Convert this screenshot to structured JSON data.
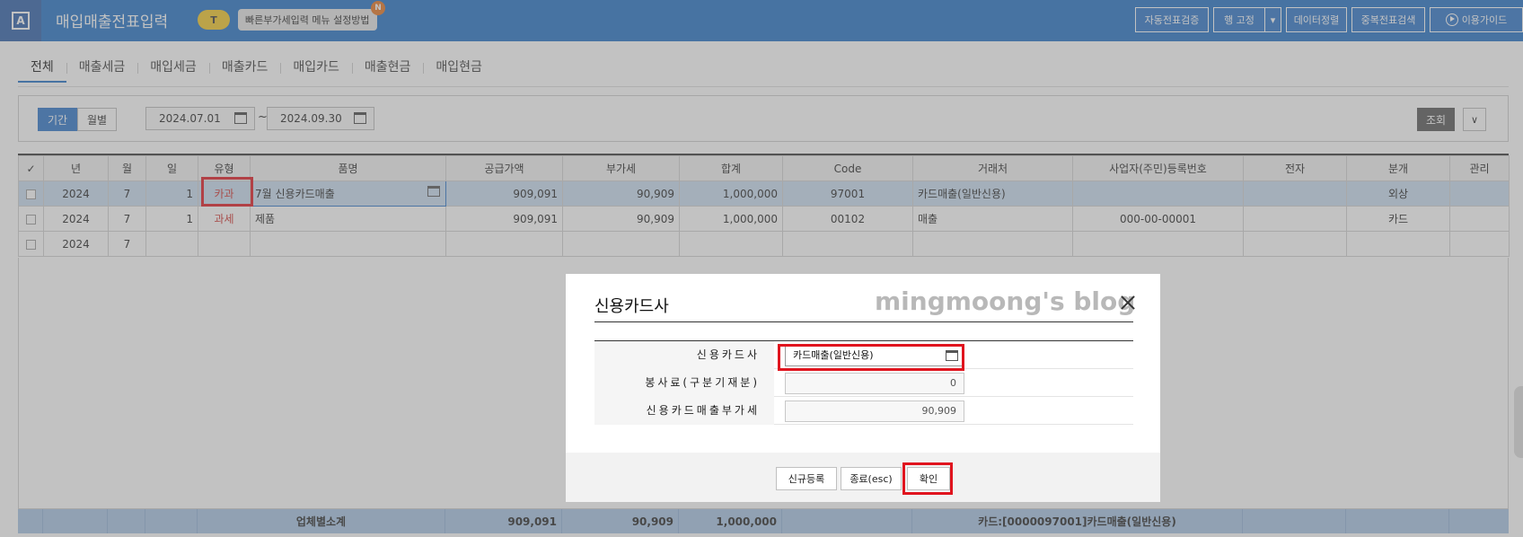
{
  "header": {
    "logo": "A",
    "title": "매입매출전표입력",
    "badge": "T",
    "tip": "빠른부가세입력 메뉴 설정방법",
    "new_badge": "N",
    "buttons": [
      "자동전표검증",
      "행 고정",
      "데이터정렬",
      "중복전표검색",
      "이용가이드"
    ],
    "split_arrow": "▾"
  },
  "tabs": [
    "전체",
    "매출세금",
    "매입세금",
    "매출카드",
    "매입카드",
    "매출현금",
    "매입현금"
  ],
  "filter": {
    "period_label": "기간",
    "monthly_label": "월별",
    "date_from": "2024.07.01",
    "date_to": "2024.09.30",
    "tilde": "~",
    "query_label": "조회",
    "expand_icon": "∨"
  },
  "grid": {
    "headers": [
      "✓",
      "년",
      "월",
      "일",
      "유형",
      "품명",
      "공급가액",
      "부가세",
      "합계",
      "Code",
      "거래처",
      "사업자(주민)등록번호",
      "전자",
      "분개",
      "관리"
    ],
    "rows": [
      [
        "",
        "2024",
        "7",
        "1",
        "카과",
        "7월 신용카드매출",
        "909,091",
        "90,909",
        "1,000,000",
        "97001",
        "카드매출(일반신용)",
        "",
        "",
        "외상",
        ""
      ],
      [
        "",
        "2024",
        "7",
        "1",
        "과세",
        "제품",
        "909,091",
        "90,909",
        "1,000,000",
        "00102",
        "매출",
        "000-00-00001",
        "",
        "카드",
        ""
      ],
      [
        "",
        "2024",
        "7",
        "",
        "",
        "",
        "",
        "",
        "",
        "",
        "",
        "",
        "",
        "",
        ""
      ]
    ]
  },
  "summary": {
    "label": "업체별소계",
    "supply": "909,091",
    "vat": "90,909",
    "total": "1,000,000",
    "note": "카드:[0000097001]카드매출(일반신용)"
  },
  "dialog": {
    "title": "신용카드사",
    "watermark": "mingmoong's blog",
    "fields": [
      {
        "label": "신용카드사",
        "value": "카드매출(일반신용)"
      },
      {
        "label": "봉사료(구분기재분)",
        "value": "0"
      },
      {
        "label": "신용카드매출부가세",
        "value": "90,909"
      }
    ],
    "buttons": [
      "신규등록",
      "종료(esc)",
      "확인"
    ]
  }
}
